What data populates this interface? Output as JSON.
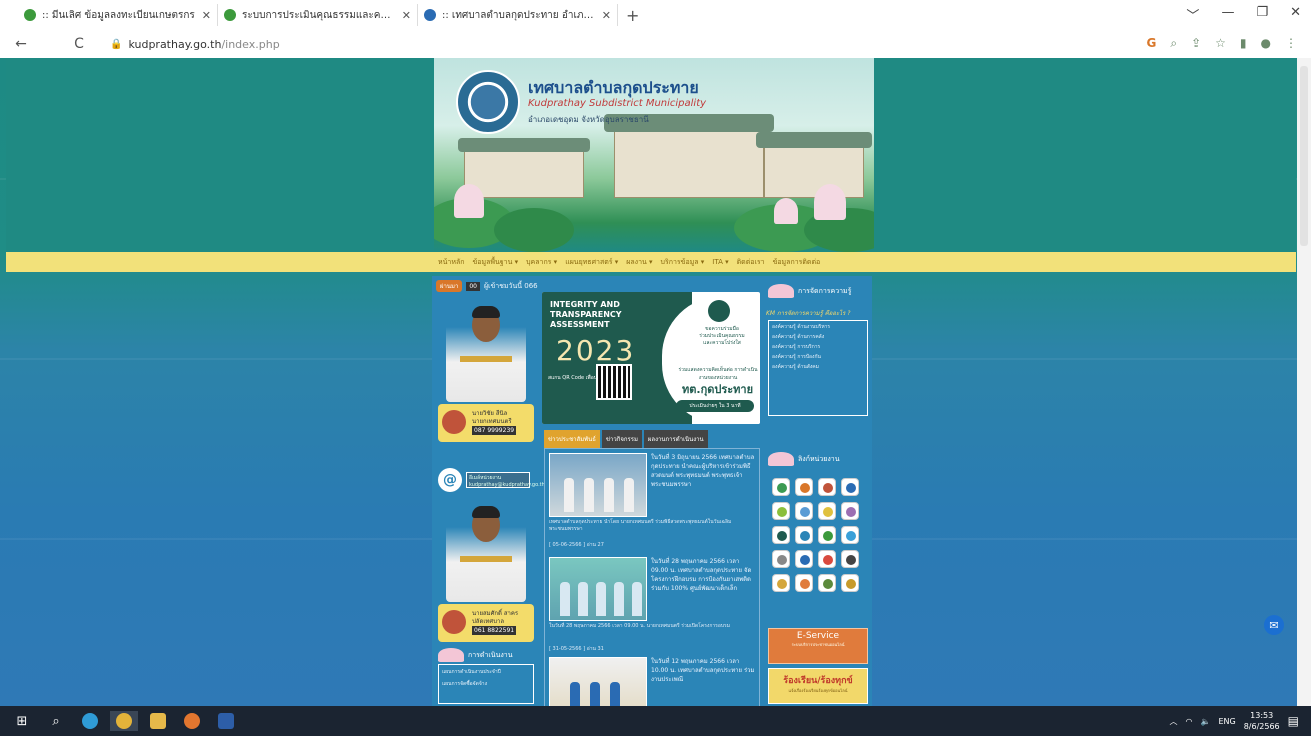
{
  "browser": {
    "tabs": [
      {
        "title": ":: มีนเลิศ ข้อมูลลงทะเบียนเกษตรกร",
        "icon": "thai-gov-favicon-icon",
        "color": "#3c9a3c"
      },
      {
        "title": "ระบบการประเมินคุณธรรมและความโปร่งใส",
        "icon": "ita-favicon-icon",
        "color": "#3c9a3c"
      },
      {
        "title": ":: เทศบาลตำบลกุดประทาย อำเภอเดชฯ",
        "icon": "municipality-favicon-icon",
        "color": "#2a6bb3"
      }
    ],
    "new_tab": "+",
    "url_host": "kudprathay.go.th",
    "url_path": "/index.php",
    "window_controls": [
      "﹀",
      "—",
      "❐",
      "✕"
    ]
  },
  "site": {
    "title": "เทศบาลตำบลกุดประทาย",
    "subtitle": "Kudprathay Subdistrict Municipality",
    "address": "อำเภอเดชอุดม จังหวัดอุบลราชธานี",
    "nav": [
      "หน้าหลัก",
      "ข้อมูลพื้นฐาน ▾",
      "บุคลากร ▾",
      "แผนยุทธศาสตร์ ▾",
      "ผลงาน ▾",
      "บริการข้อมูล ▾",
      "ITA ▾",
      "ติดต่อเรา",
      "ข้อมูลการติดต่อ"
    ],
    "date_pill": "ผ่านมา",
    "counter": "00",
    "visitor_text": "ผู้เข้าชมวันนี้ 066"
  },
  "officials": [
    {
      "name": "นายวิชัย สีนิล",
      "position": "นายกเทศมนตรี",
      "phone": "087 9999239"
    },
    {
      "name": "นายสมศักดิ์ สาคร",
      "position": "ปลัดเทศบาล",
      "phone": "061 8822591"
    }
  ],
  "email": {
    "label": "อีเมล์หน่วยงาน",
    "address": "kudprathay@kudprathay.go.th"
  },
  "ita_banner": {
    "title_lines": [
      "INTEGRITY AND",
      "TRANSPARENCY",
      "ASSESSMENT"
    ],
    "year": "2023",
    "qr_label": "สแกน QR Code เพื่อประเมินทันที",
    "right_lines": [
      "ขอความร่วมมือ",
      "ร่วมประเมินคุณธรรม",
      "และความโปร่งใส"
    ],
    "cta": "ร่วมแสดงความคิดเห็นต่อ การดำเนินงานของหน่วยงาน",
    "org_name": "ทต.กุดประทาย",
    "button": "ประเมินง่ายๆ ใน 3 นาที"
  },
  "news_tabs": [
    "ข่าวประชาสัมพันธ์",
    "ข่าวกิจกรรม",
    "ผลงานการดำเนินงาน"
  ],
  "news": [
    {
      "title": "ในวันที่ 3 มิถุนายน 2566 เทศบาลตำบลกุดประทาย นำคณะผู้บริหารเข้าร่วมพิธีสวดมนต์ พระพุทธมนต์ พระพุทธเจ้า พระชนมพรรษา",
      "body": "เทศบาลตำบลกุดประทาย นำโดย นายกเทศมนตรี ร่วมพิธีสวดพระพุทธมนต์ในวันเฉลิมพระชนมพรรษา",
      "meta": "[ 05-06-2566 ] อ่าน 27"
    },
    {
      "title": "ในวันที่ 28 พฤษภาคม 2566 เวลา 09.00 น. เทศบาลตำบลกุดประทาย จัดโครงการฝึกอบรม การป้องกันยาเสพติด ร่วมกับ 100% ศูนย์พัฒนาเด็กเล็ก",
      "body": "ในวันที่ 28 พฤษภาคม 2566 เวลา 09.00 น. นายกเทศมนตรี ร่วมเปิดโครงการอบรม",
      "meta": "[ 31-05-2566 ] อ่าน 31"
    },
    {
      "title": "ในวันที่ 12 พฤษภาคม 2566 เวลา 10.00 น. เทศบาลตำบลกุดประทาย ร่วมงานประเพณี",
      "body": "",
      "meta": ""
    }
  ],
  "knowledge": {
    "header": "การจัดการความรู้",
    "link": "KM การจัดการความรู้ คืออะไร ?",
    "items": [
      "องค์ความรู้ ด้านงานบริหาร",
      "องค์ความรู้ ด้านการคลัง",
      "องค์ความรู้ การบริการ",
      "องค์ความรู้ การป้องกัน",
      "องค์ความรู้ ด้านสังคม"
    ]
  },
  "links_header": "ลิงก์หน่วยงาน",
  "app_icons": [
    "#3c9a52",
    "#d9772a",
    "#c0533a",
    "#2a6bb3",
    "#8bbf3c",
    "#5a9bd4",
    "#e0c13e",
    "#9c6fb3",
    "#1f5a4e",
    "#2b85b7",
    "#3c9a3c",
    "#3aa0d8",
    "#888888",
    "#2a6bb3",
    "#d94a3e",
    "#444444",
    "#d4a63b",
    "#e07b3c",
    "#5c8a3c",
    "#c79a2a"
  ],
  "eservice": {
    "title": "E-Service",
    "sub": "ระบบบริการประชาชนออนไลน์"
  },
  "complaint": {
    "title": "ร้องเรียน/ร้องทุกข์",
    "sub": "แจ้งเรื่องร้องเรียนร้องทุกข์ออนไลน์"
  },
  "left_section": {
    "header": "การดำเนินงาน",
    "items": [
      "แผนการดำเนินงานประจำปี",
      "แผนการจัดซื้อจัดจ้าง"
    ]
  },
  "taskbar": {
    "lang": "ENG",
    "time": "13:53",
    "date": "8/6/2566"
  }
}
